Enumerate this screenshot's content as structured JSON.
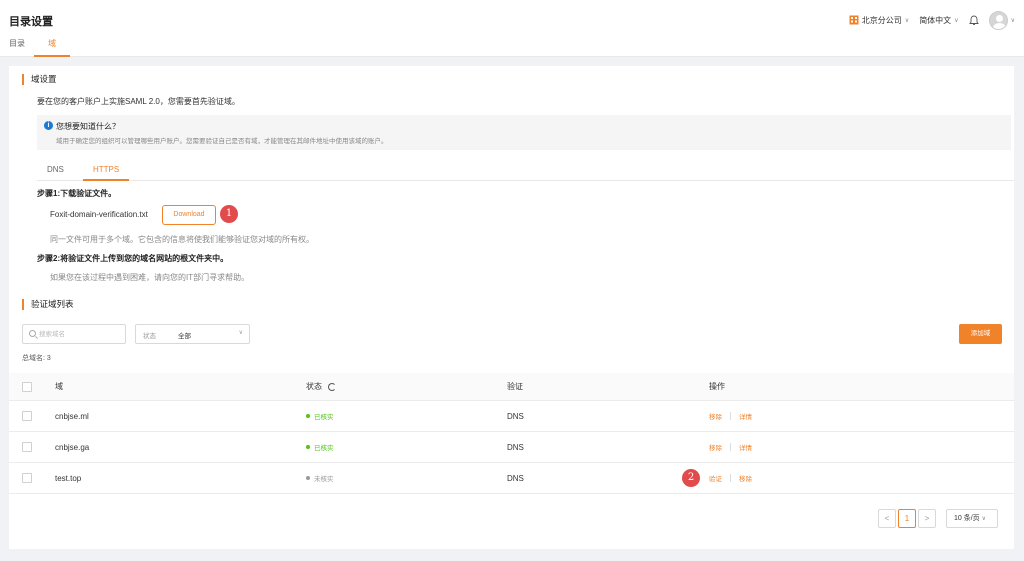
{
  "header": {
    "title": "目录设置",
    "tabs": [
      {
        "label": "目录"
      },
      {
        "label": "域"
      }
    ],
    "org": "北京分公司",
    "language": "简体中文"
  },
  "domain_settings": {
    "section_title": "域设置",
    "intro": "要在您的客户账户上实施SAML 2.0，您需要首先验证域。",
    "info_title": "您想要知道什么？",
    "info_desc": "域用于确定您的组织可以管理哪些用户账户。您需要验证自己是否有域，才能管理在其邮件地址中使用该域的账户。",
    "tabs": [
      {
        "label": "DNS"
      },
      {
        "label": "HTTPS"
      }
    ],
    "step1_title": "步骤1:下载验证文件。",
    "file_name": "Foxit-domain-verification.txt",
    "download_label": "Download",
    "step1_note": "同一文件可用于多个域。它包含的信息将使我们能够验证您对域的所有权。",
    "step2_title": "步骤2:将验证文件上传到您的域名网站的根文件夹中。",
    "step2_note": "如果您在该过程中遇到困难，请向您的IT部门寻求帮助。",
    "badge1": "1",
    "badge2": "2"
  },
  "domain_list": {
    "section_title": "验证域列表",
    "search_placeholder": "搜索域名",
    "status_filter_label": "状态",
    "status_filter_value": "全部",
    "add_label": "添加域",
    "total": "总域名: 3",
    "columns": {
      "domain": "域",
      "status": "状态",
      "verify": "验证",
      "actions": "操作"
    },
    "rows": [
      {
        "domain": "cnbjse.ml",
        "status": "已核实",
        "method": "DNS",
        "action1": "移除",
        "action2": "详情"
      },
      {
        "domain": "cnbjse.ga",
        "status": "已核实",
        "method": "DNS",
        "action1": "移除",
        "action2": "详情"
      },
      {
        "domain": "test.top",
        "status": "未核实",
        "method": "DNS",
        "action1": "验证",
        "action2": "移除"
      }
    ]
  },
  "pagination": {
    "prev": "<",
    "current": "1",
    "next": ">",
    "page_size": "10 条/页"
  },
  "colors": {
    "accent": "#f0822a",
    "verified": "#52c41a",
    "unverified": "#999999",
    "info": "#1d7bd8",
    "badge": "#e24b4b"
  },
  "icons": [
    "org-icon",
    "bell-icon",
    "avatar",
    "info-icon",
    "search-icon",
    "refresh-icon",
    "chevron-down-icon"
  ]
}
